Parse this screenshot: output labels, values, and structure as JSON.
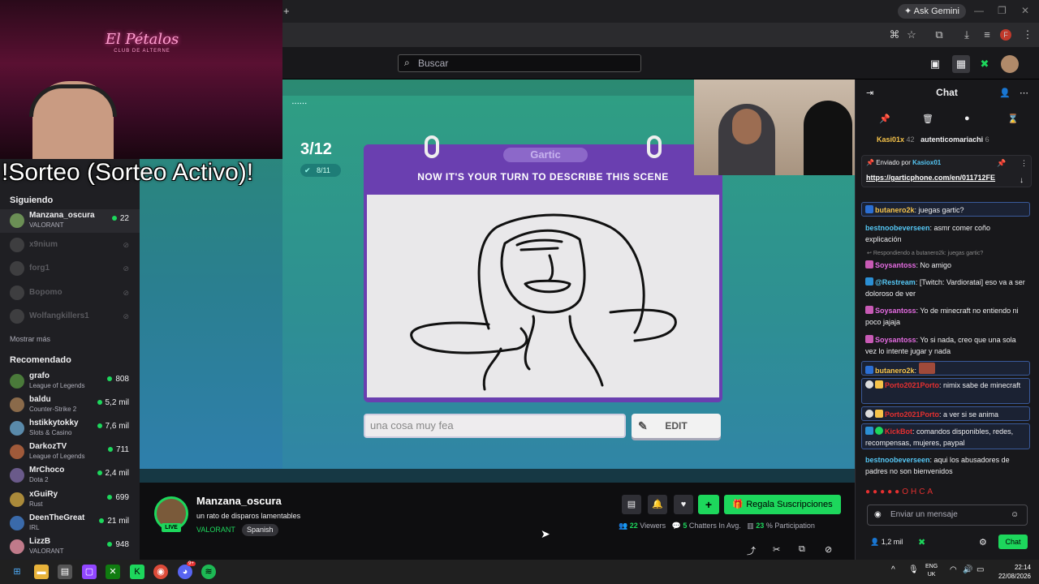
{
  "browser": {
    "ask_gemini": "Ask Gemini",
    "profile_initial": "F"
  },
  "topnav": {
    "search_placeholder": "Buscar"
  },
  "overlay": {
    "sorteo_text": "!Sorteo (Sorteo Activo)!",
    "club_sign": "El Pétalos",
    "club_sub": "CLUB DE ALTERNE"
  },
  "sidebar": {
    "following_header": "Siguiendo",
    "show_more": "Mostrar más",
    "recommended_header": "Recomendado",
    "following": [
      {
        "name": "Manzana_oscura",
        "category": "VALORANT",
        "viewers": "22",
        "live": true
      },
      {
        "name": "x9nium",
        "live": false
      },
      {
        "name": "forg1",
        "live": false
      },
      {
        "name": "Bopomo",
        "live": false
      },
      {
        "name": "Wolfangkillers1",
        "live": false
      }
    ],
    "recommended": [
      {
        "name": "grafo",
        "category": "League of Legends",
        "viewers": "808"
      },
      {
        "name": "baldu",
        "category": "Counter-Strike 2",
        "viewers": "5,2 mil"
      },
      {
        "name": "hstikkytokky",
        "category": "Slots & Casino",
        "viewers": "7,6 mil"
      },
      {
        "name": "DarkozTV",
        "category": "League of Legends",
        "viewers": "711"
      },
      {
        "name": "MrChoco",
        "category": "Dota 2",
        "viewers": "2,4 mil"
      },
      {
        "name": "xGuiRy",
        "category": "Rust",
        "viewers": "699"
      },
      {
        "name": "DeenTheGreat",
        "category": "IRL",
        "viewers": "21 mil"
      },
      {
        "name": "LizzB",
        "category": "VALORANT",
        "viewers": "948"
      }
    ]
  },
  "game": {
    "round_counter": "3/12",
    "done_badge": "8/11",
    "logo": "Gartic",
    "prompt": "NOW IT'S YOUR TURN TO DESCRIBE THIS SCENE",
    "answer_value": "una cosa muy fea",
    "edit_label": "EDIT"
  },
  "stream_info": {
    "channel_name": "Manzana_oscura",
    "stream_title": "un rato de disparos lamentables",
    "category": "VALORANT",
    "language_tag": "Spanish",
    "live_label": "LIVE",
    "gift_label": "Regala Suscripciones",
    "viewers_num": "22",
    "viewers_label": "Viewers",
    "chatters_num": "5",
    "chatters_label": "Chatters In Avg.",
    "participation_num": "23",
    "participation_label": "% Participation"
  },
  "chat": {
    "title": "Chat",
    "top_users": [
      {
        "name": "Kasi01x",
        "count": "42"
      },
      {
        "name": "autenticomariachi",
        "count": "6"
      }
    ],
    "pinned_by_label": "Enviado por",
    "pinned_by_user": "Kasiox01",
    "pinned_link": "https://garticphone.com/en/011712FE",
    "reply_note": "Respondiendo a butanero2k: juegas gartic?",
    "input_placeholder": "Enviar un mensaje",
    "send_label": "Chat",
    "followers": "1,2 mil",
    "messages": [
      {
        "user": "butanero2k",
        "text": ": juegas gartic?"
      },
      {
        "user": "bestnoobeverseen",
        "text": ": asmr comer coño explicación"
      },
      {
        "user": "Soysantoss",
        "text": ": No amigo"
      },
      {
        "user": "@Restream",
        "text": ": [Twitch: Vardioratai] eso va a ser doloroso de ver"
      },
      {
        "user": "Soysantoss",
        "text": ": Yo de minecraft no entiendo ni poco jajaja"
      },
      {
        "user": "Soysantoss",
        "text": ": Yo si nada, creo que una sola vez lo intente jugar y nada"
      },
      {
        "user": "butanero2k",
        "text": ":"
      },
      {
        "user": "Porto2021Porto",
        "text": ": nimix sabe de minecraft"
      },
      {
        "user": "Porto2021Porto",
        "text": ": a ver si se anima"
      },
      {
        "user": "KickBot",
        "text": ": comandos disponibles, redes, recompensas, mujeres, paypal"
      },
      {
        "user": "bestnoobeverseen",
        "text": ": aqui los abusadores de padres no son bienvenidos"
      }
    ]
  },
  "taskbar": {
    "lang_top": "ENG",
    "lang_bottom": "UK",
    "time": "22:14",
    "date": "22/08/2026",
    "badge_count": "9+"
  }
}
